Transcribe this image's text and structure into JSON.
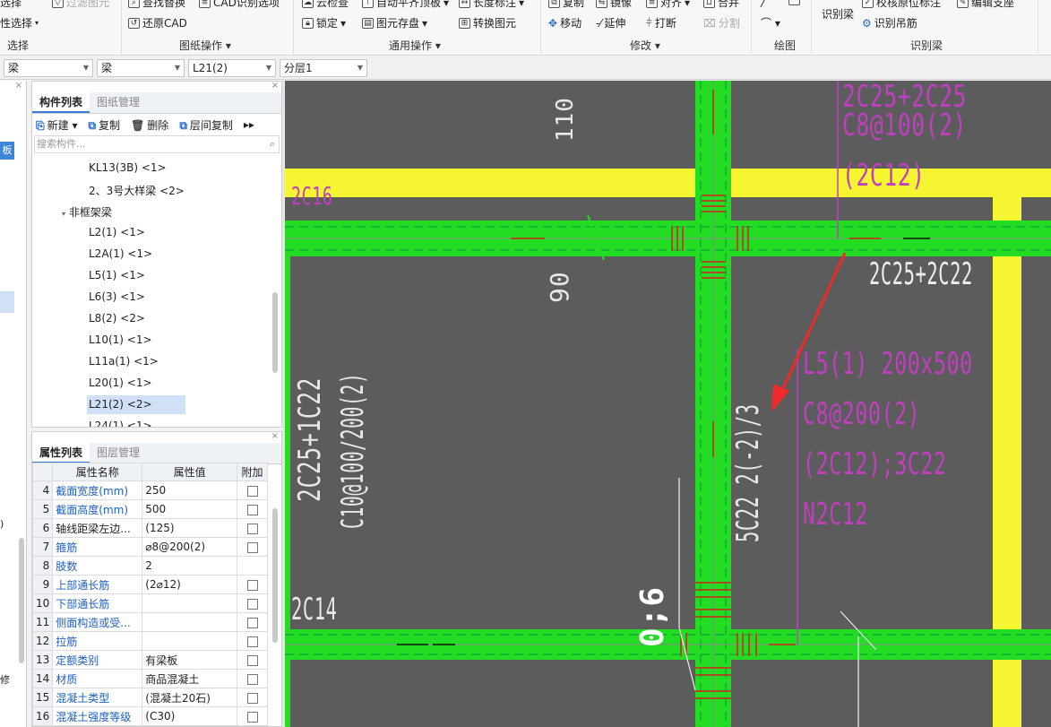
{
  "ribbon": {
    "groups": [
      {
        "label": "选择"
      },
      {
        "label": "图纸操作"
      },
      {
        "label": "通用操作"
      },
      {
        "label": "修改"
      },
      {
        "label": "绘图"
      },
      {
        "label": "识别梁"
      }
    ],
    "row0": [
      "选择",
      "查找替换",
      "CAD识别选项",
      "云检查",
      "自动平齐顶板",
      "长度标注",
      "复制",
      "镜像",
      "对齐",
      "合并",
      "校核原位标注",
      "编辑支座"
    ],
    "filter_label": "过滤图元",
    "row1": [
      "性选择",
      "还原CAD",
      "锁定",
      "图元存盘",
      "转换图元",
      "移动",
      "延伸",
      "打断",
      "分割",
      "识别吊筋"
    ],
    "identify_beam": "识别梁"
  },
  "combos": [
    {
      "value": "梁"
    },
    {
      "value": "梁"
    },
    {
      "value": "L21(2)"
    },
    {
      "value": "分层1"
    }
  ],
  "leftpane": {
    "tag": "板",
    "label0": ")",
    "label1": "修"
  },
  "component_panel": {
    "tabs": [
      "构件列表",
      "图纸管理"
    ],
    "tools": [
      "新建",
      "复制",
      "删除",
      "层间复制"
    ],
    "search_placeholder": "搜索构件...",
    "items": [
      "KL13(3B) <1>",
      "2、3号大样梁 <2>",
      "非框架梁",
      "L2(1) <1>",
      "L2A(1) <1>",
      "L5(1) <1>",
      "L6(3) <1>",
      "L8(2) <2>",
      "L10(1) <1>",
      "L11a(1) <1>",
      "L20(1) <1>",
      "L21(2) <2>",
      "L24(1) <1>"
    ],
    "selected": "L21(2) <2>"
  },
  "property_panel": {
    "tabs": [
      "属性列表",
      "图层管理"
    ],
    "headers": [
      "属性名称",
      "属性值",
      "附加"
    ],
    "rows": [
      {
        "n": "4",
        "name": "截面宽度(mm)",
        "value": "250",
        "blue": true
      },
      {
        "n": "5",
        "name": "截面高度(mm)",
        "value": "500",
        "blue": true
      },
      {
        "n": "6",
        "name": "轴线距梁左边...",
        "value": "(125)",
        "blue": false
      },
      {
        "n": "7",
        "name": "箍筋",
        "value": "⌀8@200(2)",
        "blue": true
      },
      {
        "n": "8",
        "name": "肢数",
        "value": "2",
        "blue": true
      },
      {
        "n": "9",
        "name": "上部通长筋",
        "value": "(2⌀12)",
        "blue": true
      },
      {
        "n": "10",
        "name": "下部通长筋",
        "value": "",
        "blue": true
      },
      {
        "n": "11",
        "name": "侧面构造或受...",
        "value": "",
        "blue": true
      },
      {
        "n": "12",
        "name": "拉筋",
        "value": "",
        "blue": true
      },
      {
        "n": "13",
        "name": "定额类别",
        "value": "有梁板",
        "blue": true
      },
      {
        "n": "14",
        "name": "材质",
        "value": "商品混凝土",
        "blue": true
      },
      {
        "n": "15",
        "name": "混凝土类型",
        "value": "(混凝土20石)",
        "blue": true
      },
      {
        "n": "16",
        "name": "混凝土强度等级",
        "value": "(C30)",
        "blue": true
      }
    ]
  },
  "canvas": {
    "texts": {
      "t2c16": "2C16",
      "t110": "110",
      "t90": "90",
      "tc8": "C8@100(2)",
      "t2c12": "(2C12)",
      "ttop": "2C25+2C25",
      "t2c25b": "2C25+2C22",
      "tl5": "L5(1) 200x500",
      "tc8b": "C8@200(2)",
      "t2c12b": "(2C12);3C22",
      "tn2": "N2C12",
      "tleft1": "2C25+1C22",
      "tleft2": "C10@100/200(2)",
      "tmid": "5C22 2(-2)/3",
      "t2c14": "2C14",
      "t06": "0;6"
    },
    "colors": {
      "beam": "#22dd22",
      "yellow": "#f5f531",
      "magenta": "#c040c0",
      "arrow": "#ee2a2a"
    }
  }
}
